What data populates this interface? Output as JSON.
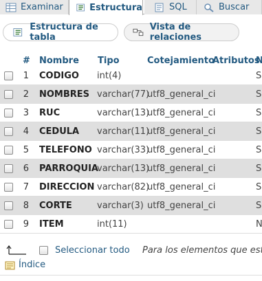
{
  "tabs": {
    "browse": "Examinar",
    "structure": "Estructura",
    "sql": "SQL",
    "search": "Buscar"
  },
  "subtabs": {
    "structure": "Estructura de tabla",
    "relations": "Vista de relaciones"
  },
  "table": {
    "headers": {
      "num": "#",
      "name": "Nombre",
      "type": "Tipo",
      "collation": "Cotejamiento",
      "attributes": "Atributos",
      "null": "N"
    },
    "rows": [
      {
        "num": "1",
        "name": "CODIGO",
        "type": "int(4)",
        "collation": "",
        "null": "S"
      },
      {
        "num": "2",
        "name": "NOMBRES",
        "type": "varchar(77)",
        "collation": "utf8_general_ci",
        "null": "S"
      },
      {
        "num": "3",
        "name": "RUC",
        "type": "varchar(13)",
        "collation": "utf8_general_ci",
        "null": "S"
      },
      {
        "num": "4",
        "name": "CEDULA",
        "type": "varchar(11)",
        "collation": "utf8_general_ci",
        "null": "S"
      },
      {
        "num": "5",
        "name": "TELEFONO",
        "type": "varchar(33)",
        "collation": "utf8_general_ci",
        "null": "S"
      },
      {
        "num": "6",
        "name": "PARROQUIA",
        "type": "varchar(13)",
        "collation": "utf8_general_ci",
        "null": "S"
      },
      {
        "num": "7",
        "name": "DIRECCION",
        "type": "varchar(82)",
        "collation": "utf8_general_ci",
        "null": "S"
      },
      {
        "num": "8",
        "name": "CORTE",
        "type": "varchar(3)",
        "collation": "utf8_general_ci",
        "null": "S"
      },
      {
        "num": "9",
        "name": "ITEM",
        "type": "int(11)",
        "collation": "",
        "null": "N"
      }
    ]
  },
  "footer": {
    "select_all": "Seleccionar todo",
    "hint": "Para los elementos que están",
    "index": "Índice"
  },
  "colors": {
    "accent": "#235a81",
    "row_alt": "#dfdfdf"
  }
}
